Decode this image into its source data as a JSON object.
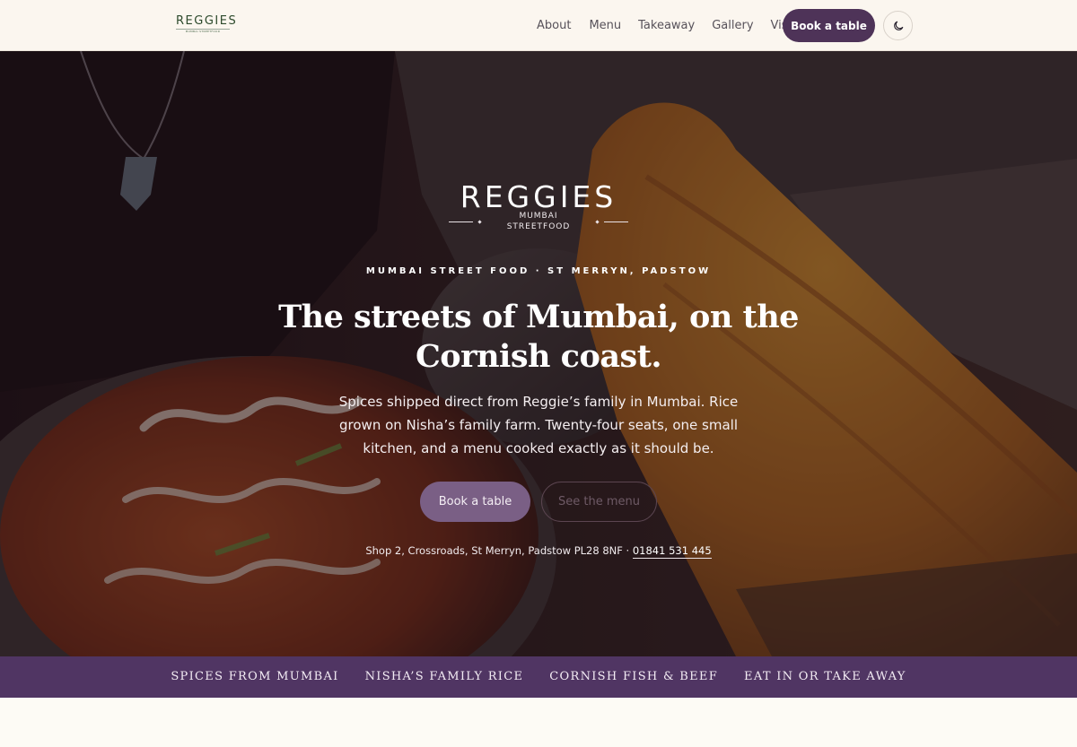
{
  "nav": {
    "logo_word": "REGGIES",
    "logo_sub": "MUMBAI STREETFOOD",
    "links": [
      "About",
      "Menu",
      "Takeaway",
      "Gallery",
      "Visit"
    ],
    "book_label": "Book a table",
    "theme_icon": "moon-icon"
  },
  "hero": {
    "logo_word": "REGGIES",
    "logo_sub": "MUMBAI STREETFOOD",
    "eyebrow": "MUMBAI STREET FOOD · ST MERRYN, PADSTOW",
    "title": "The streets of Mumbai, on the Cornish coast.",
    "body": "Spices shipped direct from Reggie’s family in Mumbai. Rice grown on Nisha’s family farm. Twenty-four seats, one small kitchen, and a menu cooked exactly as it should be.",
    "book_label": "Book a table",
    "menu_label": "See the menu",
    "address": "Shop 2, Crossroads, St Merryn, Padstow PL28 8NF · ",
    "phone": "01841 531 445"
  },
  "strip": {
    "items": [
      "SPICES FROM MUMBAI",
      "NISHA’S FAMILY RICE",
      "CORNISH FISH & BEEF",
      "EAT IN OR TAKE AWAY"
    ]
  },
  "colors": {
    "brand_purple": "#503563",
    "nav_bg": "#fbf6ef",
    "logo_green": "#2d4a2c"
  }
}
